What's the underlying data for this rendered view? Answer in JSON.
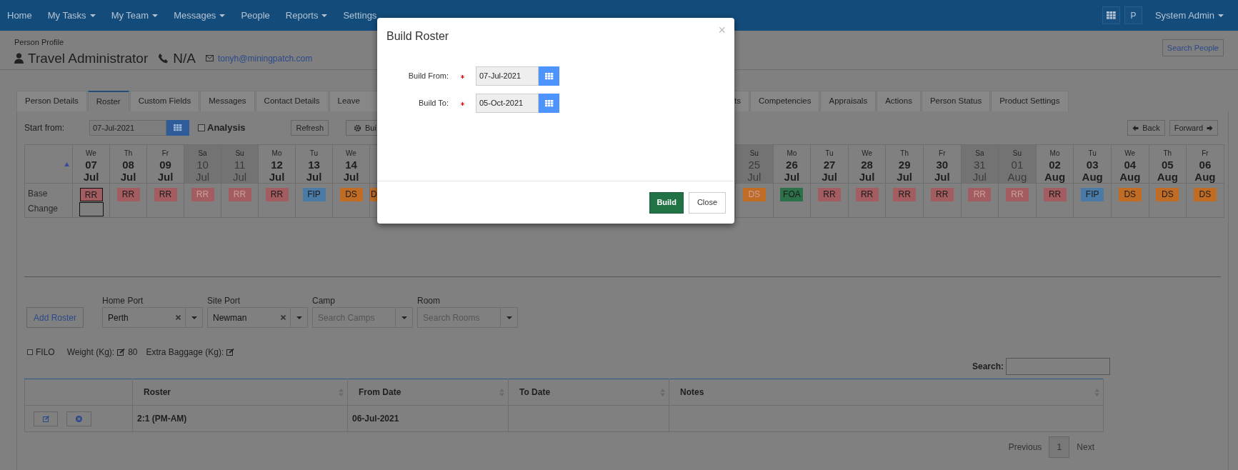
{
  "navbar": {
    "items": [
      {
        "label": "Home",
        "dropdown": false
      },
      {
        "label": "My Tasks",
        "dropdown": true
      },
      {
        "label": "My Team",
        "dropdown": true
      },
      {
        "label": "Messages",
        "dropdown": true
      },
      {
        "label": "People",
        "dropdown": false
      },
      {
        "label": "Reports",
        "dropdown": true
      },
      {
        "label": "Settings",
        "dropdown": false
      }
    ],
    "profile_initial": "P",
    "user_menu": "System Admin"
  },
  "header": {
    "breadcrumb": "Person Profile",
    "name": "Travel Administrator",
    "phone": "N/A",
    "email": "tonyh@miningpatch.com",
    "search_button": "Search People"
  },
  "tabs": [
    {
      "label": "Person Details",
      "selected": false,
      "kind": "tab"
    },
    {
      "label": "Roster",
      "selected": true,
      "kind": "tab"
    },
    {
      "label": "Custom Fields",
      "selected": false,
      "kind": "tab"
    },
    {
      "label": "Messages",
      "selected": false,
      "kind": "tab"
    },
    {
      "label": "Contact Details",
      "selected": false,
      "kind": "tab"
    },
    {
      "label": "Leave",
      "selected": false,
      "kind": "tab"
    },
    {
      "label": "ts",
      "selected": false,
      "kind": "cut"
    },
    {
      "label": "Competencies",
      "selected": false,
      "kind": "tab"
    },
    {
      "label": "Appraisals",
      "selected": false,
      "kind": "tab"
    },
    {
      "label": "Actions",
      "selected": false,
      "kind": "tab"
    },
    {
      "label": "Person Status",
      "selected": false,
      "kind": "tab"
    },
    {
      "label": "Product Settings",
      "selected": false,
      "kind": "tab"
    }
  ],
  "toolbar": {
    "start_label": "Start from:",
    "start_date": "07-Jul-2021",
    "analysis_label": "Analysis",
    "analysis_checked": false,
    "refresh": "Refresh",
    "build": "Bui",
    "back": "Back",
    "forward": "Forward"
  },
  "calendar": {
    "row_labels": [
      "Base",
      "Change"
    ],
    "days": [
      {
        "kind": "day",
        "weekday": "We",
        "day": "07",
        "month": "Jul",
        "weekend": false,
        "selected": true,
        "shift": "RR",
        "color": "#a35d60"
      },
      {
        "kind": "day",
        "weekday": "Th",
        "day": "08",
        "month": "Jul",
        "weekend": false,
        "selected": false,
        "shift": "RR",
        "color": "#a35d60"
      },
      {
        "kind": "day",
        "weekday": "Fr",
        "day": "09",
        "month": "Jul",
        "weekend": false,
        "selected": false,
        "shift": "RR",
        "color": "#a35d60"
      },
      {
        "kind": "day",
        "weekday": "Sa",
        "day": "10",
        "month": "Jul",
        "weekend": true,
        "selected": false,
        "shift": "RR",
        "color": "#a35d60"
      },
      {
        "kind": "day",
        "weekday": "Su",
        "day": "11",
        "month": "Jul",
        "weekend": true,
        "selected": false,
        "shift": "RR",
        "color": "#a35d60"
      },
      {
        "kind": "day",
        "weekday": "Mo",
        "day": "12",
        "month": "Jul",
        "weekend": false,
        "selected": false,
        "shift": "RR",
        "color": "#a35d60"
      },
      {
        "kind": "day",
        "weekday": "Tu",
        "day": "13",
        "month": "Jul",
        "weekend": false,
        "selected": false,
        "shift": "FIP",
        "color": "#4a7aa6"
      },
      {
        "kind": "day",
        "weekday": "We",
        "day": "14",
        "month": "Jul",
        "weekend": false,
        "selected": false,
        "shift": "DS",
        "color": "#c06c24"
      },
      {
        "kind": "cut",
        "shift": "D",
        "color": "#c06c24"
      },
      {
        "kind": "day",
        "weekday": "Su",
        "day": "25",
        "month": "Jul",
        "weekend": true,
        "selected": false,
        "shift": "DS",
        "color": "#c06c24"
      },
      {
        "kind": "day",
        "weekday": "Mo",
        "day": "26",
        "month": "Jul",
        "weekend": false,
        "selected": false,
        "shift": "FOA",
        "color": "#2b7049"
      },
      {
        "kind": "day",
        "weekday": "Tu",
        "day": "27",
        "month": "Jul",
        "weekend": false,
        "selected": false,
        "shift": "RR",
        "color": "#a35d60"
      },
      {
        "kind": "day",
        "weekday": "We",
        "day": "28",
        "month": "Jul",
        "weekend": false,
        "selected": false,
        "shift": "RR",
        "color": "#a35d60"
      },
      {
        "kind": "day",
        "weekday": "Th",
        "day": "29",
        "month": "Jul",
        "weekend": false,
        "selected": false,
        "shift": "RR",
        "color": "#a35d60"
      },
      {
        "kind": "day",
        "weekday": "Fr",
        "day": "30",
        "month": "Jul",
        "weekend": false,
        "selected": false,
        "shift": "RR",
        "color": "#a35d60"
      },
      {
        "kind": "day",
        "weekday": "Sa",
        "day": "31",
        "month": "Jul",
        "weekend": true,
        "selected": false,
        "shift": "RR",
        "color": "#a35d60"
      },
      {
        "kind": "day",
        "weekday": "Su",
        "day": "01",
        "month": "Aug",
        "weekend": true,
        "selected": false,
        "shift": "RR",
        "color": "#a35d60"
      },
      {
        "kind": "day",
        "weekday": "Mo",
        "day": "02",
        "month": "Aug",
        "weekend": false,
        "selected": false,
        "shift": "RR",
        "color": "#a35d60"
      },
      {
        "kind": "day",
        "weekday": "Tu",
        "day": "03",
        "month": "Aug",
        "weekend": false,
        "selected": false,
        "shift": "FIP",
        "color": "#4a7aa6"
      },
      {
        "kind": "day",
        "weekday": "We",
        "day": "04",
        "month": "Aug",
        "weekend": false,
        "selected": false,
        "shift": "DS",
        "color": "#c06c24"
      },
      {
        "kind": "day",
        "weekday": "Th",
        "day": "05",
        "month": "Aug",
        "weekend": false,
        "selected": false,
        "shift": "DS",
        "color": "#c06c24"
      },
      {
        "kind": "day",
        "weekday": "Fr",
        "day": "06",
        "month": "Aug",
        "weekend": false,
        "selected": false,
        "shift": "DS",
        "color": "#c06c24"
      }
    ]
  },
  "assignment": {
    "add_button": "Add Roster",
    "selects": [
      {
        "label": "Home Port",
        "value": "Perth",
        "clearable": true
      },
      {
        "label": "Site Port",
        "value": "Newman",
        "clearable": true
      },
      {
        "label": "Camp",
        "placeholder": "Search Camps",
        "clearable": false
      },
      {
        "label": "Room",
        "placeholder": "Search Rooms",
        "clearable": false
      }
    ]
  },
  "options": {
    "filo_label": "FILO",
    "filo_checked": false,
    "weight_label": "Weight (Kg):",
    "weight_value": "80",
    "baggage_label": "Extra Baggage (Kg):"
  },
  "table": {
    "search_label": "Search:",
    "columns": [
      "Roster",
      "From Date",
      "To Date",
      "Notes"
    ],
    "rows": [
      {
        "roster": "2:1 (PM-AM)",
        "from_date": "06-Jul-2021"
      }
    ]
  },
  "pagination": {
    "previous": "Previous",
    "pages": [
      {
        "label": "1",
        "selected": true
      }
    ],
    "next": "Next"
  },
  "dialog": {
    "title": "Build Roster",
    "close_glyph": "×",
    "fields": [
      {
        "label": "Build From:",
        "required": true,
        "value": "07-Jul-2021"
      },
      {
        "label": "Build To:",
        "required": true,
        "value": "05-Oct-2021"
      }
    ],
    "buttons": [
      {
        "label": "Build",
        "kind": "primary"
      },
      {
        "label": "Close",
        "kind": "secondary"
      }
    ]
  }
}
